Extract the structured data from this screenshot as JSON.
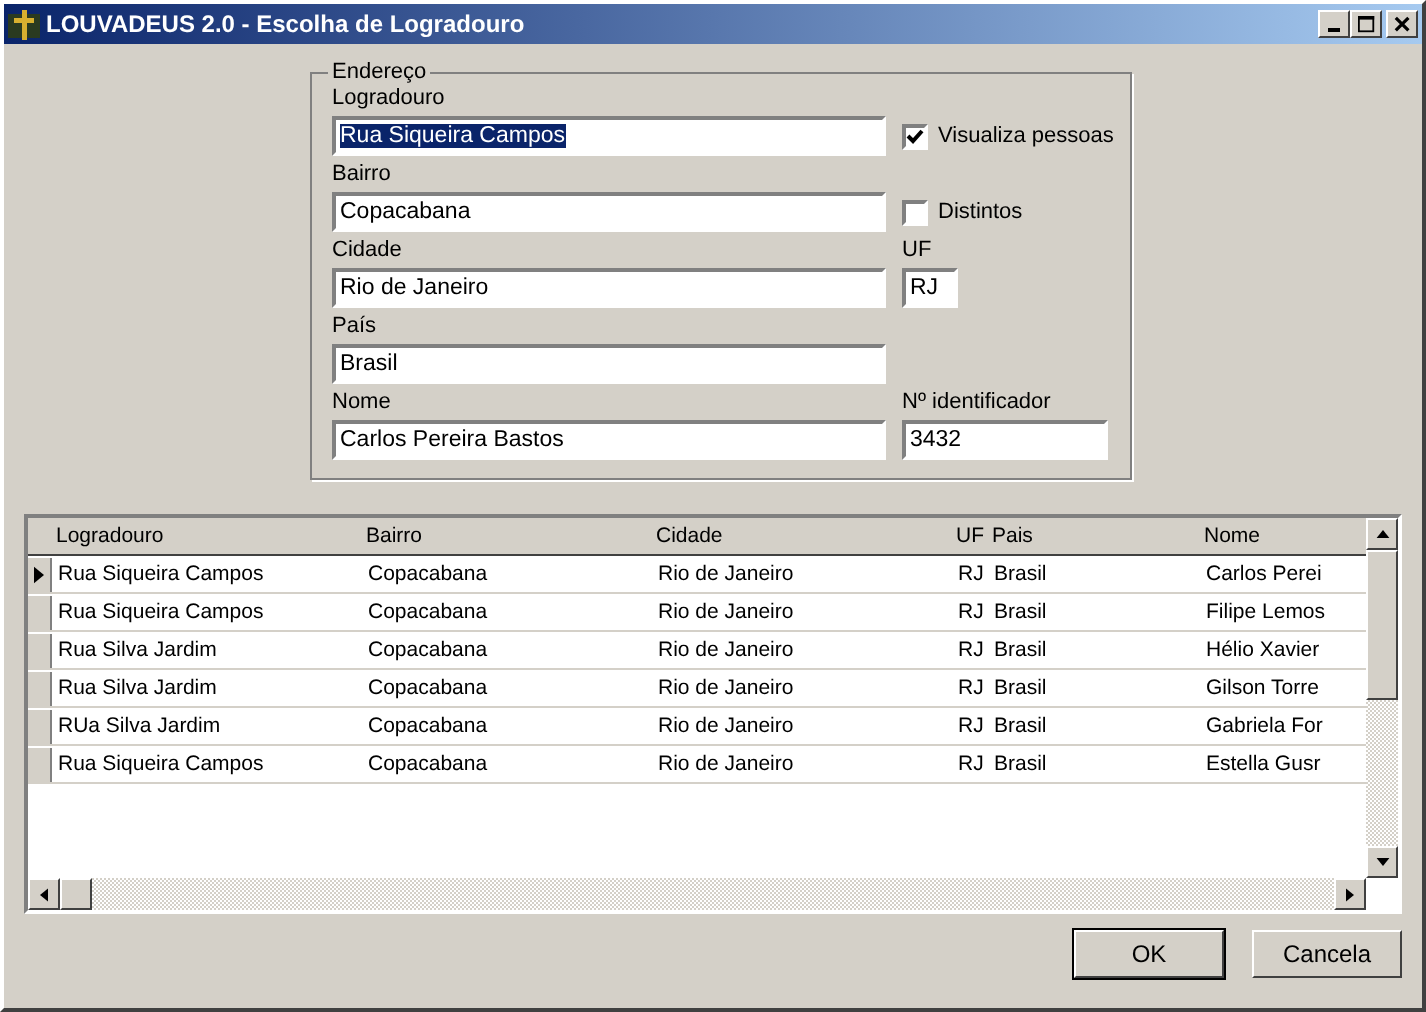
{
  "window": {
    "title": "LOUVADEUS 2.0 - Escolha de Logradouro"
  },
  "address": {
    "legend": "Endereço",
    "rows": [
      {
        "main": {
          "label": "Logradouro",
          "value": "Rua Siqueira Campos",
          "highlighted": true
        },
        "side": {
          "kind": "checkbox",
          "label": "Visualiza pessoas",
          "checked": true
        }
      },
      {
        "main": {
          "label": "Bairro",
          "value": "Copacabana",
          "highlighted": false
        },
        "side": {
          "kind": "checkbox",
          "label": "Distintos",
          "checked": false
        }
      },
      {
        "main": {
          "label": "Cidade",
          "value": "Rio de Janeiro",
          "highlighted": false
        },
        "side": {
          "kind": "small-field",
          "label": "UF",
          "value": "RJ"
        }
      },
      {
        "main": {
          "label": "País",
          "value": "Brasil",
          "highlighted": false
        }
      },
      {
        "main": {
          "label": "Nome",
          "value": "Carlos Pereira Bastos",
          "highlighted": false
        },
        "side": {
          "kind": "field",
          "label": "Nº identificador",
          "value": "3432"
        }
      }
    ]
  },
  "table": {
    "columns": [
      "Logradouro",
      "Bairro",
      "Cidade",
      "UF",
      "Pais",
      "Nome"
    ],
    "rows": [
      {
        "selected": true,
        "cells": [
          "Rua Siqueira Campos",
          "Copacabana",
          "Rio de Janeiro",
          "RJ",
          "Brasil",
          "Carlos Perei"
        ]
      },
      {
        "selected": false,
        "cells": [
          "Rua Siqueira Campos",
          "Copacabana",
          "Rio de Janeiro",
          "RJ",
          "Brasil",
          "Filipe Lemos"
        ]
      },
      {
        "selected": false,
        "cells": [
          "Rua Silva Jardim",
          "Copacabana",
          "Rio de Janeiro",
          "RJ",
          "Brasil",
          "Hélio Xavier"
        ]
      },
      {
        "selected": false,
        "cells": [
          "Rua Silva Jardim",
          "Copacabana",
          "Rio de Janeiro",
          "RJ",
          "Brasil",
          "Gilson Torre"
        ]
      },
      {
        "selected": false,
        "cells": [
          "RUa Silva Jardim",
          "Copacabana",
          "Rio de Janeiro",
          "RJ",
          "Brasil",
          "Gabriela For"
        ]
      },
      {
        "selected": false,
        "cells": [
          "Rua Siqueira Campos",
          "Copacabana",
          "Rio de Janeiro",
          "RJ",
          "Brasil",
          "Estella Gusr"
        ]
      }
    ]
  },
  "buttons": [
    {
      "label": "OK",
      "default": true
    },
    {
      "label": "Cancela",
      "default": false
    }
  ]
}
